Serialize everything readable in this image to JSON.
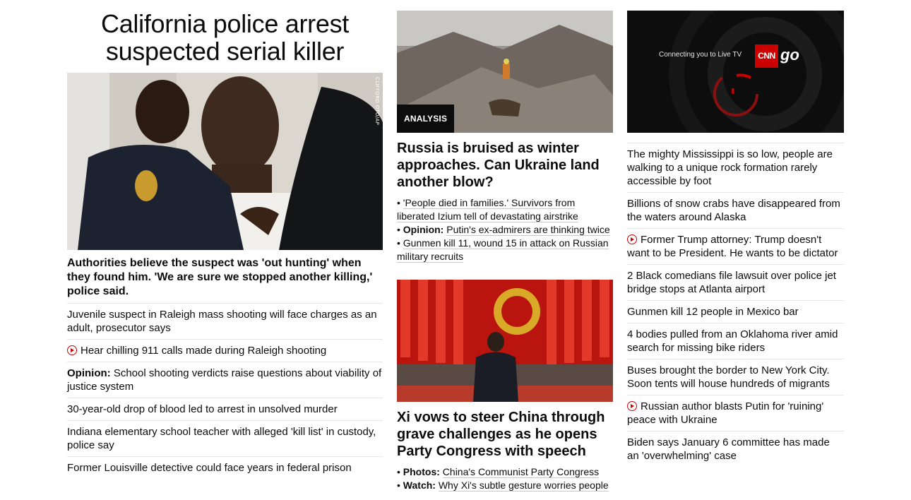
{
  "lead": {
    "headline": "California police arrest suspected serial killer",
    "image_credit": "CLIFFORD OTO/AP",
    "summary": "Authorities believe the suspect was 'out hunting' when they found him. 'We are sure we stopped another killing,' police said.",
    "stories": [
      {
        "text": "Juvenile suspect in Raleigh mass shooting will face charges as an adult, prosecutor says",
        "video": false,
        "prefix": ""
      },
      {
        "text": "Hear chilling 911 calls made during Raleigh shooting",
        "video": true,
        "prefix": ""
      },
      {
        "text": "School shooting verdicts raise questions about viability of justice system",
        "video": false,
        "prefix": "Opinion:"
      },
      {
        "text": "30-year-old drop of blood led to arrest in unsolved murder",
        "video": false,
        "prefix": ""
      },
      {
        "text": "Indiana elementary school teacher with alleged 'kill list' in custody, police say",
        "video": false,
        "prefix": ""
      },
      {
        "text": "Former Louisville detective could face years in federal prison",
        "video": false,
        "prefix": ""
      }
    ]
  },
  "mid": {
    "story1": {
      "badge": "ANALYSIS",
      "headline": "Russia is bruised as winter approaches. Can Ukraine land another blow?",
      "bullets": [
        {
          "prefix": "",
          "text": "'People died in families.' Survivors from liberated Izium tell of devastating airstrike"
        },
        {
          "prefix": "Opinion:",
          "text": "Putin's ex-admirers are thinking twice"
        },
        {
          "prefix": "",
          "text": "Gunmen kill 11, wound 15 in attack on Russian military recruits"
        }
      ]
    },
    "story2": {
      "headline": "Xi vows to steer China through grave challenges as he opens Party Congress with speech",
      "bullets": [
        {
          "prefix": "Photos:",
          "text": "China's Communist Party Congress"
        },
        {
          "prefix": "Watch:",
          "text": "Why Xi's subtle gesture worries people"
        }
      ]
    }
  },
  "right": {
    "video": {
      "text": "Connecting you to Live TV",
      "logo": "CNN",
      "go": "go"
    },
    "stories": [
      {
        "text": "The mighty Mississippi is so low, people are walking to a unique rock formation rarely accessible by foot",
        "video": false
      },
      {
        "text": "Billions of snow crabs have disappeared from the waters around Alaska",
        "video": false
      },
      {
        "text": "Former Trump attorney: Trump doesn't want to be President. He wants to be dictator",
        "video": true
      },
      {
        "text": "2 Black comedians file lawsuit over police jet bridge stops at Atlanta airport",
        "video": false
      },
      {
        "text": "Gunmen kill 12 people in Mexico bar",
        "video": false
      },
      {
        "text": "4 bodies pulled from an Oklahoma river amid search for missing bike riders",
        "video": false
      },
      {
        "text": "Buses brought the border to New York City. Soon tents will house hundreds of migrants",
        "video": false
      },
      {
        "text": "Russian author blasts Putin for 'ruining' peace with Ukraine",
        "video": true
      },
      {
        "text": "Biden says January 6 committee has made an 'overwhelming' case",
        "video": false
      }
    ]
  },
  "colors": {
    "accent": "#cc0000",
    "text": "#0c0c0c",
    "divider": "#e6e6e6"
  }
}
